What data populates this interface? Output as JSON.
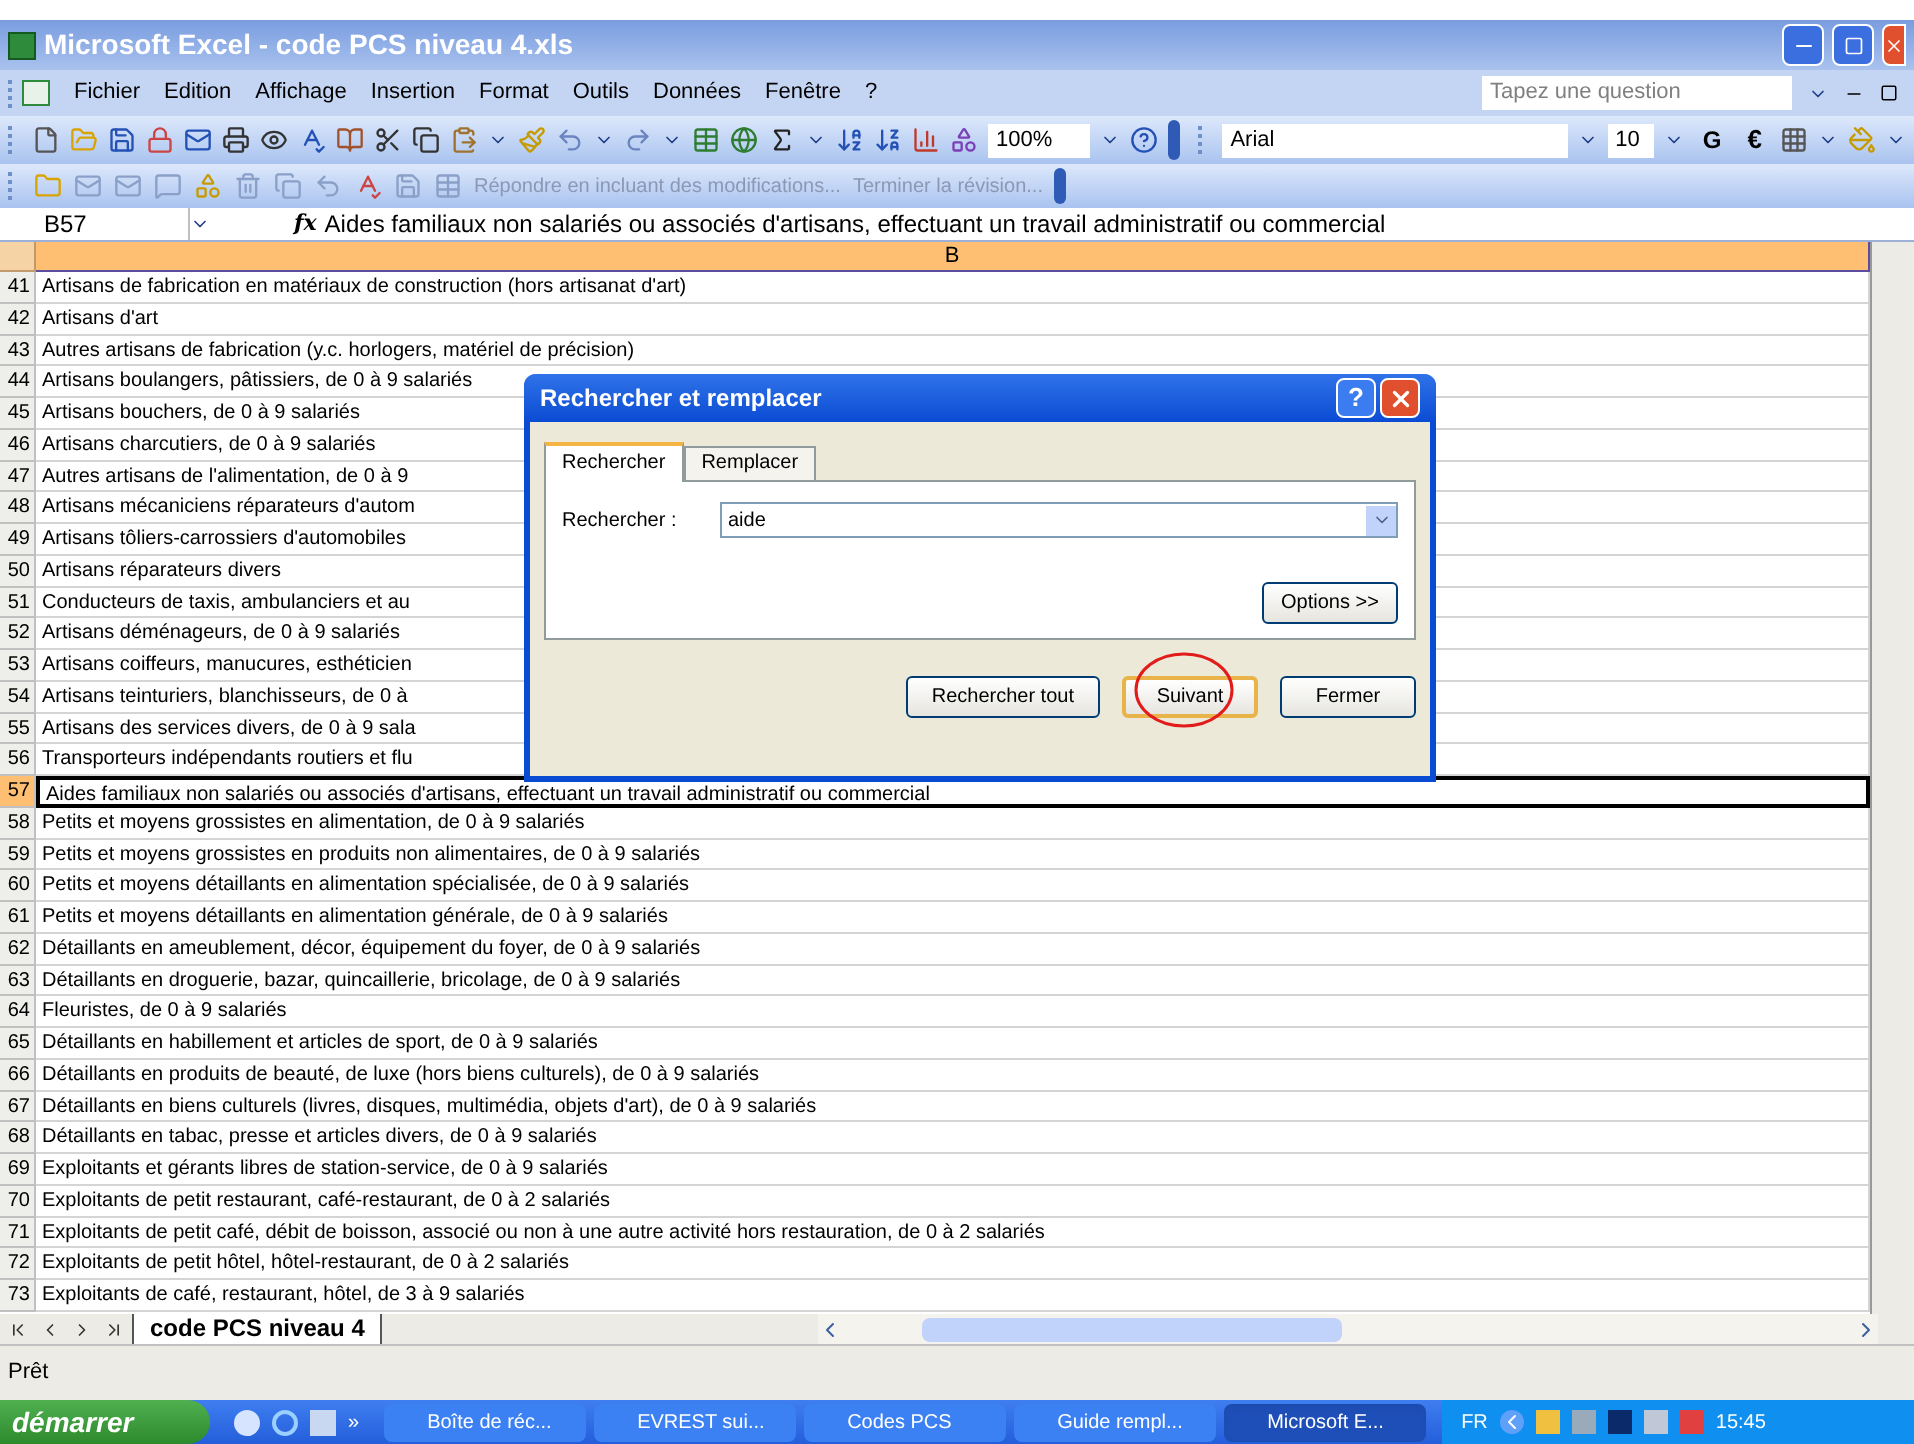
{
  "window": {
    "title": "Microsoft Excel - code PCS niveau 4.xls"
  },
  "menu": [
    "Fichier",
    "Edition",
    "Affichage",
    "Insertion",
    "Format",
    "Outils",
    "Données",
    "Fenêtre",
    "?"
  ],
  "question_box": {
    "placeholder": "Tapez une question"
  },
  "standard_toolbar": {
    "zoom": "100%"
  },
  "format_toolbar": {
    "font": "Arial",
    "size": "10",
    "bold": "G",
    "currency": "€"
  },
  "review_toolbar": {
    "reply": "Répondre en incluant des modifications...",
    "finish": "Terminer la révision..."
  },
  "formula_bar": {
    "name_box": "B57",
    "function_label": "fx",
    "formula": "Aides familiaux non salariés ou associés d'artisans, effectuant un travail administratif ou commercial"
  },
  "columns": [
    "B"
  ],
  "rows": [
    {
      "number": "41",
      "text": "Artisans de fabrication en matériaux de construction (hors artisanat d'art)",
      "selected": false
    },
    {
      "number": "42",
      "text": "Artisans d'art",
      "selected": false
    },
    {
      "number": "43",
      "text": "Autres artisans de fabrication (y.c. horlogers, matériel de précision)",
      "selected": false
    },
    {
      "number": "44",
      "text": "Artisans boulangers, pâtissiers, de 0 à 9 salariés",
      "selected": false
    },
    {
      "number": "45",
      "text": "Artisans bouchers, de 0 à 9 salariés",
      "selected": false
    },
    {
      "number": "46",
      "text": "Artisans charcutiers, de 0 à 9 salariés",
      "selected": false
    },
    {
      "number": "47",
      "text": "Autres artisans de l'alimentation, de 0 à 9",
      "selected": false
    },
    {
      "number": "48",
      "text": "Artisans mécaniciens réparateurs d'autom",
      "selected": false
    },
    {
      "number": "49",
      "text": "Artisans tôliers-carrossiers d'automobiles",
      "selected": false
    },
    {
      "number": "50",
      "text": "Artisans réparateurs divers",
      "selected": false
    },
    {
      "number": "51",
      "text": "Conducteurs de taxis, ambulanciers et au",
      "selected": false
    },
    {
      "number": "52",
      "text": "Artisans déménageurs, de 0 à 9 salariés",
      "selected": false
    },
    {
      "number": "53",
      "text": "Artisans coiffeurs, manucures, esthéticien",
      "selected": false
    },
    {
      "number": "54",
      "text": "Artisans teinturiers, blanchisseurs, de 0 à",
      "selected": false
    },
    {
      "number": "55",
      "text": "Artisans des services divers, de 0 à 9 sala",
      "selected": false
    },
    {
      "number": "56",
      "text": "Transporteurs indépendants routiers et flu",
      "selected": false
    },
    {
      "number": "57",
      "text": "Aides familiaux non salariés ou associés d'artisans, effectuant un travail administratif ou commercial",
      "selected": true
    },
    {
      "number": "58",
      "text": "Petits et moyens grossistes en alimentation, de 0 à 9 salariés",
      "selected": false
    },
    {
      "number": "59",
      "text": "Petits et moyens grossistes en produits non alimentaires, de 0 à 9 salariés",
      "selected": false
    },
    {
      "number": "60",
      "text": "Petits et moyens détaillants en alimentation spécialisée, de 0 à 9 salariés",
      "selected": false
    },
    {
      "number": "61",
      "text": "Petits et moyens détaillants en alimentation générale, de 0 à 9 salariés",
      "selected": false
    },
    {
      "number": "62",
      "text": "Détaillants en ameublement, décor, équipement du foyer, de 0 à 9 salariés",
      "selected": false
    },
    {
      "number": "63",
      "text": "Détaillants en droguerie, bazar, quincaillerie, bricolage, de 0 à 9 salariés",
      "selected": false
    },
    {
      "number": "64",
      "text": "Fleuristes, de 0 à 9 salariés",
      "selected": false
    },
    {
      "number": "65",
      "text": "Détaillants en habillement et articles de sport, de 0 à 9 salariés",
      "selected": false
    },
    {
      "number": "66",
      "text": "Détaillants en produits de beauté, de luxe (hors biens culturels), de 0 à 9 salariés",
      "selected": false
    },
    {
      "number": "67",
      "text": "Détaillants en biens culturels (livres, disques, multimédia, objets d'art), de 0 à 9 salariés",
      "selected": false
    },
    {
      "number": "68",
      "text": "Détaillants en tabac, presse et articles divers, de 0 à 9 salariés",
      "selected": false
    },
    {
      "number": "69",
      "text": "Exploitants et gérants libres de station-service, de 0 à 9 salariés",
      "selected": false
    },
    {
      "number": "70",
      "text": "Exploitants de petit restaurant, café-restaurant, de 0 à 2 salariés",
      "selected": false
    },
    {
      "number": "71",
      "text": "Exploitants de petit café, débit de boisson, associé ou non à une autre activité hors restauration, de 0 à 2 salariés",
      "selected": false
    },
    {
      "number": "72",
      "text": "Exploitants de petit hôtel, hôtel-restaurant, de 0 à 2 salariés",
      "selected": false
    },
    {
      "number": "73",
      "text": "Exploitants de café, restaurant, hôtel, de 3 à 9 salariés",
      "selected": false
    }
  ],
  "dialog": {
    "title": "Rechercher et remplacer",
    "help": "?",
    "tabs": [
      {
        "label": "Rechercher",
        "selected": true
      },
      {
        "label": "Remplacer",
        "selected": false
      }
    ],
    "field_label": "Rechercher :",
    "value": "aide",
    "options": "Options >>",
    "buttons": [
      {
        "label": "Rechercher tout",
        "highlighted": false
      },
      {
        "label": "Suivant",
        "highlighted": true
      },
      {
        "label": "Fermer",
        "highlighted": false
      }
    ]
  },
  "sheet_tabs": [
    {
      "label": "code PCS niveau 4",
      "selected": true
    }
  ],
  "status_bar": {
    "text": "Prêt"
  },
  "taskbar": {
    "start": "démarrer",
    "more": "»",
    "tasks": [
      {
        "label": "Boîte de réc...",
        "selected": false
      },
      {
        "label": "EVREST sui...",
        "selected": false
      },
      {
        "label": "Codes PCS",
        "selected": false
      },
      {
        "label": "Guide rempl...",
        "selected": false
      },
      {
        "label": "Microsoft E...",
        "selected": true
      }
    ],
    "language": "FR",
    "clock": "15:45"
  }
}
